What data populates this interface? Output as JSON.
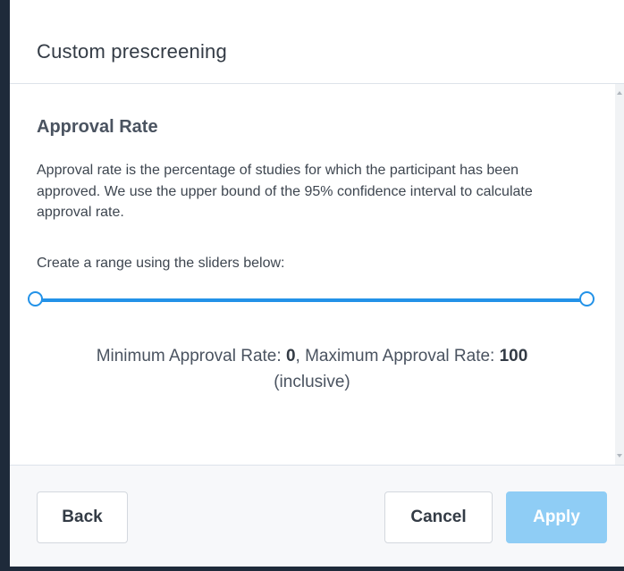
{
  "modal": {
    "title": "Custom prescreening"
  },
  "section": {
    "title": "Approval Rate",
    "description": "Approval rate is the percentage of studies for which the participant has been approved. We use the upper bound of the 95% confidence interval to calculate approval rate.",
    "range_hint": "Create a range using the sliders below:"
  },
  "slider": {
    "min_value": 0,
    "max_value": 100,
    "accent_color": "#2392e8"
  },
  "summary": {
    "min_label": "Minimum Approval Rate: ",
    "min_value": "0",
    "separator": ", Maximum Approval Rate: ",
    "max_value": "100",
    "suffix": "(inclusive)"
  },
  "footer": {
    "back_label": "Back",
    "cancel_label": "Cancel",
    "apply_label": "Apply",
    "apply_color": "#8fcdf5"
  }
}
